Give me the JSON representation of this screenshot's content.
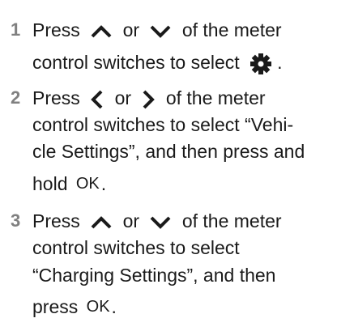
{
  "steps": [
    {
      "number": "1",
      "lines": [
        {
          "t1": "Press",
          "t2": "or",
          "t3": "of the meter"
        },
        {
          "t1": "control switches to select",
          "t2": "."
        }
      ],
      "icons": [
        "chevron-up-icon",
        "chevron-down-icon",
        "gear-icon"
      ]
    },
    {
      "number": "2",
      "lines": [
        {
          "t1": "Press",
          "t2": "or",
          "t3": "of the meter"
        },
        {
          "t1": "control switches to select “Vehi-"
        },
        {
          "t1": "cle Settings”, and then press and"
        },
        {
          "t1": "hold",
          "ok": "OK",
          "t2": "."
        }
      ],
      "icons": [
        "chevron-left-icon",
        "chevron-right-icon"
      ]
    },
    {
      "number": "3",
      "lines": [
        {
          "t1": "Press",
          "t2": "or",
          "t3": "of the meter"
        },
        {
          "t1": "control switches to select"
        },
        {
          "t1": "“Charging Settings”, and then"
        },
        {
          "t1": "press",
          "ok": "OK",
          "t2": "."
        }
      ],
      "icons": [
        "chevron-up-icon",
        "chevron-down-icon"
      ]
    }
  ]
}
